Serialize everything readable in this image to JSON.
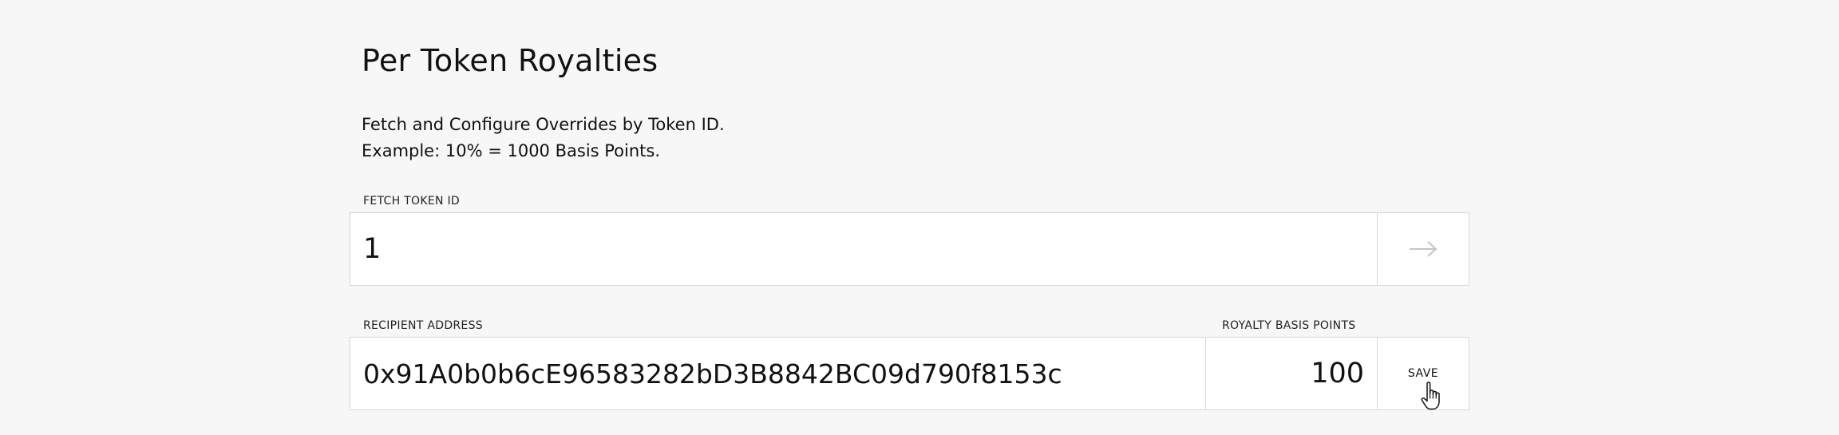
{
  "header": {
    "title": "Per Token Royalties"
  },
  "description": {
    "line1": "Fetch and Configure Overrides by Token ID.",
    "line2": "Example: 10% = 1000 Basis Points."
  },
  "fetch": {
    "label": "FETCH TOKEN ID",
    "token_id_value": "1",
    "button_icon": "arrow-right-icon"
  },
  "override": {
    "recipient_label": "RECIPIENT ADDRESS",
    "recipient_value": "0x91A0b0b6cE96583282bD3B8842BC09d790f8153c",
    "bps_label": "ROYALTY BASIS POINTS",
    "bps_value": "100",
    "save_label": "SAVE"
  },
  "cursor": {
    "icon": "hand-pointer-icon"
  },
  "colors": {
    "background": "#f7f7f7",
    "field_background": "#ffffff",
    "border": "#d6d6d6",
    "text": "#111111",
    "arrow": "#c4c4c4"
  }
}
